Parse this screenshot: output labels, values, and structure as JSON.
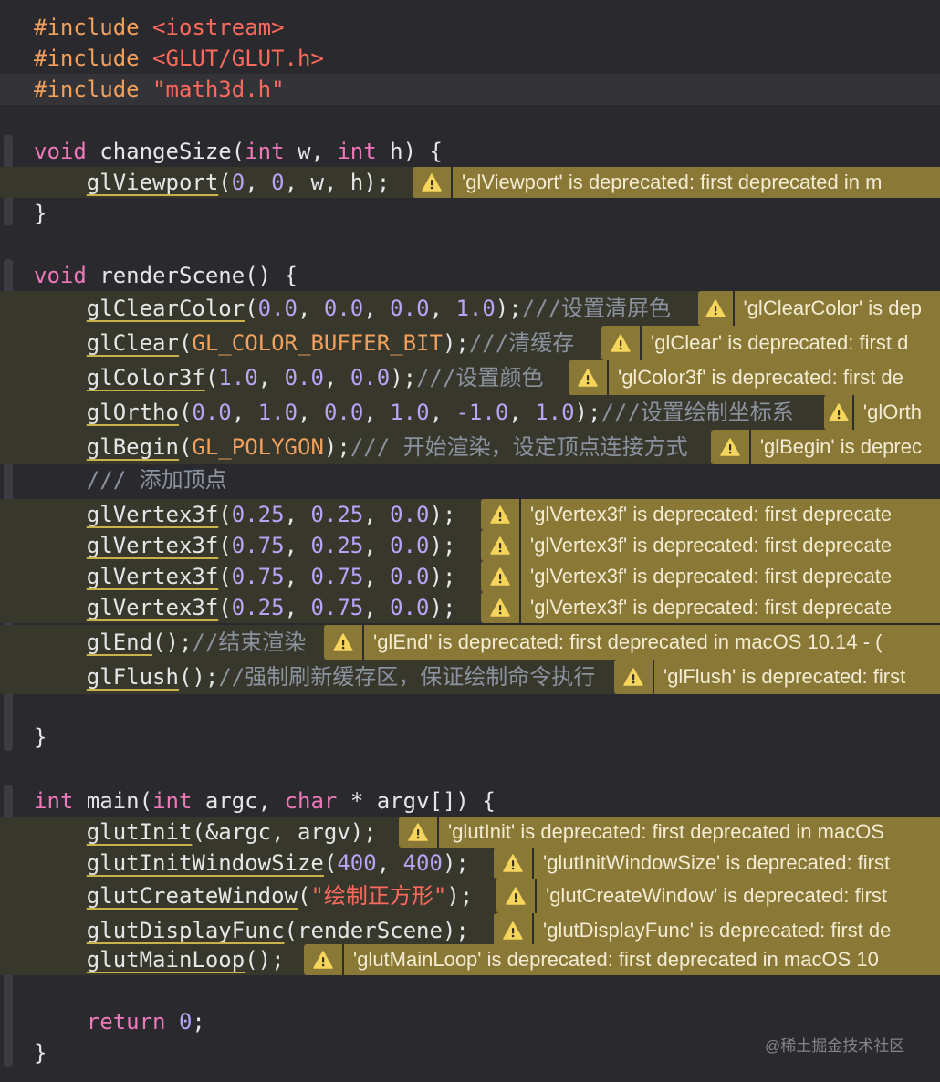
{
  "editor": {
    "lines": [
      {
        "tokens": [
          {
            "text": "#include ",
            "cls": "pp"
          },
          {
            "text": "<iostream>",
            "cls": "str"
          }
        ]
      },
      {
        "tokens": [
          {
            "text": "#include ",
            "cls": "pp"
          },
          {
            "text": "<GLUT/GLUT.h>",
            "cls": "str"
          }
        ]
      },
      {
        "tokens": [
          {
            "text": "#include ",
            "cls": "pp"
          },
          {
            "text": "\"math3d.h\"",
            "cls": "str"
          }
        ]
      },
      {
        "tokens": [
          {
            "text": "void",
            "cls": "kw"
          },
          {
            "text": " changeSize(",
            "cls": ""
          },
          {
            "text": "int",
            "cls": "kw"
          },
          {
            "text": " w, ",
            "cls": ""
          },
          {
            "text": "int",
            "cls": "kw"
          },
          {
            "text": " h) {",
            "cls": ""
          }
        ]
      },
      {
        "tokens": [
          {
            "text": "    ",
            "cls": ""
          },
          {
            "text": "glViewport",
            "cls": "fn"
          },
          {
            "text": "(",
            "cls": ""
          },
          {
            "text": "0",
            "cls": "num"
          },
          {
            "text": ", ",
            "cls": ""
          },
          {
            "text": "0",
            "cls": "num"
          },
          {
            "text": ", w, h);",
            "cls": ""
          }
        ],
        "warning": "'glViewport' is deprecated: first deprecated in m"
      },
      {
        "tokens": [
          {
            "text": "}",
            "cls": ""
          }
        ]
      },
      {
        "tokens": [
          {
            "text": "void",
            "cls": "kw"
          },
          {
            "text": " renderScene() {",
            "cls": ""
          }
        ]
      },
      {
        "tokens": [
          {
            "text": "    ",
            "cls": ""
          },
          {
            "text": "glClearColor",
            "cls": "fn"
          },
          {
            "text": "(",
            "cls": ""
          },
          {
            "text": "0.0",
            "cls": "num"
          },
          {
            "text": ", ",
            "cls": ""
          },
          {
            "text": "0.0",
            "cls": "num"
          },
          {
            "text": ", ",
            "cls": ""
          },
          {
            "text": "0.0",
            "cls": "num"
          },
          {
            "text": ", ",
            "cls": ""
          },
          {
            "text": "1.0",
            "cls": "num"
          },
          {
            "text": ");",
            "cls": ""
          },
          {
            "text": "///设置清屏色",
            "cls": "cm"
          }
        ],
        "warning": "'glClearColor' is dep"
      },
      {
        "tokens": [
          {
            "text": "    ",
            "cls": ""
          },
          {
            "text": "glClear",
            "cls": "fn"
          },
          {
            "text": "(",
            "cls": ""
          },
          {
            "text": "GL_COLOR_BUFFER_BIT",
            "cls": "pp"
          },
          {
            "text": ");",
            "cls": ""
          },
          {
            "text": "///清缓存",
            "cls": "cm"
          }
        ],
        "warning": "'glClear' is deprecated: first d"
      },
      {
        "tokens": [
          {
            "text": "    ",
            "cls": ""
          },
          {
            "text": "glColor3f",
            "cls": "fn"
          },
          {
            "text": "(",
            "cls": ""
          },
          {
            "text": "1.0",
            "cls": "num"
          },
          {
            "text": ", ",
            "cls": ""
          },
          {
            "text": "0.0",
            "cls": "num"
          },
          {
            "text": ", ",
            "cls": ""
          },
          {
            "text": "0.0",
            "cls": "num"
          },
          {
            "text": ");",
            "cls": ""
          },
          {
            "text": "///设置颜色",
            "cls": "cm"
          }
        ],
        "warning": "'glColor3f' is deprecated: first de"
      },
      {
        "tokens": [
          {
            "text": "    ",
            "cls": ""
          },
          {
            "text": "glOrtho",
            "cls": "fn"
          },
          {
            "text": "(",
            "cls": ""
          },
          {
            "text": "0.0",
            "cls": "num"
          },
          {
            "text": ", ",
            "cls": ""
          },
          {
            "text": "1.0",
            "cls": "num"
          },
          {
            "text": ", ",
            "cls": ""
          },
          {
            "text": "0.0",
            "cls": "num"
          },
          {
            "text": ", ",
            "cls": ""
          },
          {
            "text": "1.0",
            "cls": "num"
          },
          {
            "text": ", ",
            "cls": ""
          },
          {
            "text": "-1.0",
            "cls": "num"
          },
          {
            "text": ", ",
            "cls": ""
          },
          {
            "text": "1.0",
            "cls": "num"
          },
          {
            "text": ");",
            "cls": ""
          },
          {
            "text": "///设置绘制坐标系",
            "cls": "cm"
          }
        ],
        "warning": "'glOrth"
      },
      {
        "tokens": [
          {
            "text": "    ",
            "cls": ""
          },
          {
            "text": "glBegin",
            "cls": "fn"
          },
          {
            "text": "(",
            "cls": ""
          },
          {
            "text": "GL_POLYGON",
            "cls": "pp"
          },
          {
            "text": ");",
            "cls": ""
          },
          {
            "text": "/// 开始渲染，设定顶点连接方式",
            "cls": "cm"
          }
        ],
        "warning": "'glBegin' is deprec"
      },
      {
        "tokens": [
          {
            "text": "    ",
            "cls": ""
          },
          {
            "text": "/// 添加顶点",
            "cls": "cm"
          }
        ]
      },
      {
        "tokens": [
          {
            "text": "    ",
            "cls": ""
          },
          {
            "text": "glVertex3f",
            "cls": "fn"
          },
          {
            "text": "(",
            "cls": ""
          },
          {
            "text": "0.25",
            "cls": "num"
          },
          {
            "text": ", ",
            "cls": ""
          },
          {
            "text": "0.25",
            "cls": "num"
          },
          {
            "text": ", ",
            "cls": ""
          },
          {
            "text": "0.0",
            "cls": "num"
          },
          {
            "text": ");",
            "cls": ""
          }
        ],
        "warning": "'glVertex3f' is deprecated: first deprecate"
      },
      {
        "tokens": [
          {
            "text": "    ",
            "cls": ""
          },
          {
            "text": "glVertex3f",
            "cls": "fn"
          },
          {
            "text": "(",
            "cls": ""
          },
          {
            "text": "0.75",
            "cls": "num"
          },
          {
            "text": ", ",
            "cls": ""
          },
          {
            "text": "0.25",
            "cls": "num"
          },
          {
            "text": ", ",
            "cls": ""
          },
          {
            "text": "0.0",
            "cls": "num"
          },
          {
            "text": ");",
            "cls": ""
          }
        ],
        "warning": "'glVertex3f' is deprecated: first deprecate"
      },
      {
        "tokens": [
          {
            "text": "    ",
            "cls": ""
          },
          {
            "text": "glVertex3f",
            "cls": "fn"
          },
          {
            "text": "(",
            "cls": ""
          },
          {
            "text": "0.75",
            "cls": "num"
          },
          {
            "text": ", ",
            "cls": ""
          },
          {
            "text": "0.75",
            "cls": "num"
          },
          {
            "text": ", ",
            "cls": ""
          },
          {
            "text": "0.0",
            "cls": "num"
          },
          {
            "text": ");",
            "cls": ""
          }
        ],
        "warning": "'glVertex3f' is deprecated: first deprecate"
      },
      {
        "tokens": [
          {
            "text": "    ",
            "cls": ""
          },
          {
            "text": "glVertex3f",
            "cls": "fn"
          },
          {
            "text": "(",
            "cls": ""
          },
          {
            "text": "0.25",
            "cls": "num"
          },
          {
            "text": ", ",
            "cls": ""
          },
          {
            "text": "0.75",
            "cls": "num"
          },
          {
            "text": ", ",
            "cls": ""
          },
          {
            "text": "0.0",
            "cls": "num"
          },
          {
            "text": ");",
            "cls": ""
          }
        ],
        "warning": "'glVertex3f' is deprecated: first deprecate"
      },
      {
        "tokens": [
          {
            "text": "    ",
            "cls": ""
          },
          {
            "text": "glEnd",
            "cls": "fn"
          },
          {
            "text": "();",
            "cls": ""
          },
          {
            "text": "//结束渲染",
            "cls": "cm"
          }
        ],
        "warning": "'glEnd' is deprecated: first deprecated in macOS 10.14 - ("
      },
      {
        "tokens": [
          {
            "text": "    ",
            "cls": ""
          },
          {
            "text": "glFlush",
            "cls": "fn"
          },
          {
            "text": "();",
            "cls": ""
          },
          {
            "text": "//强制刷新缓存区，保证绘制命令执行",
            "cls": "cm"
          }
        ],
        "warning": "'glFlush' is deprecated: first"
      },
      {
        "tokens": [
          {
            "text": "}",
            "cls": ""
          }
        ]
      },
      {
        "tokens": [
          {
            "text": "int",
            "cls": "kw"
          },
          {
            "text": " main(",
            "cls": ""
          },
          {
            "text": "int",
            "cls": "kw"
          },
          {
            "text": " argc, ",
            "cls": ""
          },
          {
            "text": "char",
            "cls": "kw"
          },
          {
            "text": " * argv[]) {",
            "cls": ""
          }
        ]
      },
      {
        "tokens": [
          {
            "text": "    ",
            "cls": ""
          },
          {
            "text": "glutInit",
            "cls": "fn"
          },
          {
            "text": "(&argc, argv);",
            "cls": ""
          }
        ],
        "warning": "'glutInit' is deprecated: first deprecated in macOS"
      },
      {
        "tokens": [
          {
            "text": "    ",
            "cls": ""
          },
          {
            "text": "glutInitWindowSize",
            "cls": "fn"
          },
          {
            "text": "(",
            "cls": ""
          },
          {
            "text": "400",
            "cls": "num"
          },
          {
            "text": ", ",
            "cls": ""
          },
          {
            "text": "400",
            "cls": "num"
          },
          {
            "text": ");",
            "cls": ""
          }
        ],
        "warning": "'glutInitWindowSize' is deprecated: first"
      },
      {
        "tokens": [
          {
            "text": "    ",
            "cls": ""
          },
          {
            "text": "glutCreateWindow",
            "cls": "fn"
          },
          {
            "text": "(",
            "cls": ""
          },
          {
            "text": "\"绘制正方形\"",
            "cls": "str"
          },
          {
            "text": ");",
            "cls": ""
          }
        ],
        "warning": "'glutCreateWindow' is deprecated: first"
      },
      {
        "tokens": [
          {
            "text": "    ",
            "cls": ""
          },
          {
            "text": "glutDisplayFunc",
            "cls": "fn"
          },
          {
            "text": "(renderScene);",
            "cls": ""
          }
        ],
        "warning": "'glutDisplayFunc' is deprecated: first de"
      },
      {
        "tokens": [
          {
            "text": "    ",
            "cls": ""
          },
          {
            "text": "glutMainLoop",
            "cls": "fn"
          },
          {
            "text": "();",
            "cls": ""
          }
        ],
        "warning": "'glutMainLoop' is deprecated: first deprecated in macOS 10"
      },
      {
        "tokens": [
          {
            "text": "    ",
            "cls": ""
          },
          {
            "text": "return",
            "cls": "kw"
          },
          {
            "text": " ",
            "cls": ""
          },
          {
            "text": "0",
            "cls": "num"
          },
          {
            "text": ";",
            "cls": ""
          }
        ]
      },
      {
        "tokens": [
          {
            "text": "}",
            "cls": ""
          }
        ]
      }
    ]
  },
  "watermark": "@稀土掘金技术社区",
  "colors": {
    "background": "#2a2a2e",
    "preprocessor": "#f2a05d",
    "string": "#fc6a5d",
    "keyword": "#ee78b9",
    "number": "#b5a5f5",
    "comment": "#8a929e",
    "warning_badge": "#8a7837",
    "warning_line": "#37372c"
  },
  "icons": {
    "warning": "warning-triangle-icon"
  }
}
